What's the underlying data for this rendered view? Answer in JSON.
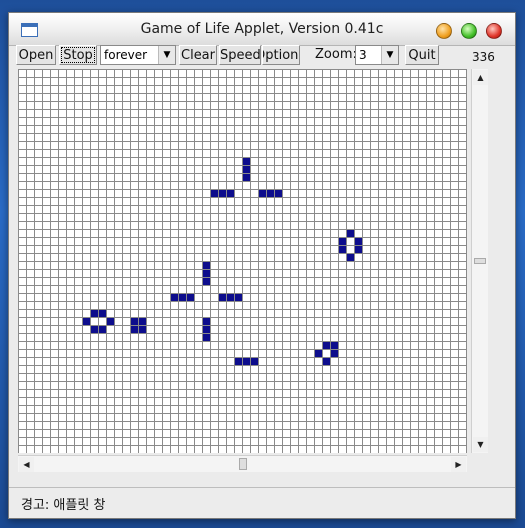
{
  "window": {
    "title": "Game of Life Applet, Version 0.41c"
  },
  "toolbar": {
    "open_label": "Open",
    "stop_label": "Stop",
    "speed_select_value": "forever",
    "clear_label": "Clear",
    "speed_label": "Speed",
    "options_label": "Options",
    "zoom_label": "Zoom:",
    "zoom_value": "3",
    "quit_label": "Quit",
    "generation_count": "336"
  },
  "grid": {
    "cell_color": "#0d0d8c",
    "line_color": "#8a8a8a",
    "columns": 56,
    "rows": 48,
    "live_cells": [
      [
        28,
        11
      ],
      [
        28,
        12
      ],
      [
        28,
        13
      ],
      [
        24,
        15
      ],
      [
        25,
        15
      ],
      [
        26,
        15
      ],
      [
        30,
        15
      ],
      [
        31,
        15
      ],
      [
        32,
        15
      ],
      [
        41,
        20
      ],
      [
        40,
        21
      ],
      [
        42,
        21
      ],
      [
        40,
        22
      ],
      [
        42,
        22
      ],
      [
        41,
        23
      ],
      [
        23,
        24
      ],
      [
        23,
        25
      ],
      [
        23,
        26
      ],
      [
        19,
        28
      ],
      [
        20,
        28
      ],
      [
        21,
        28
      ],
      [
        25,
        28
      ],
      [
        26,
        28
      ],
      [
        27,
        28
      ],
      [
        9,
        30
      ],
      [
        10,
        30
      ],
      [
        8,
        31
      ],
      [
        11,
        31
      ],
      [
        9,
        32
      ],
      [
        10,
        32
      ],
      [
        14,
        31
      ],
      [
        15,
        31
      ],
      [
        14,
        32
      ],
      [
        15,
        32
      ],
      [
        23,
        31
      ],
      [
        23,
        32
      ],
      [
        23,
        33
      ],
      [
        38,
        34
      ],
      [
        39,
        34
      ],
      [
        37,
        35
      ],
      [
        39,
        35
      ],
      [
        38,
        36
      ],
      [
        27,
        36
      ],
      [
        28,
        36
      ],
      [
        29,
        36
      ]
    ]
  },
  "scrollbars": {
    "vertical_position": 0.5,
    "horizontal_position": 0.5
  },
  "status": {
    "text": "경고: 애플릿 창"
  }
}
